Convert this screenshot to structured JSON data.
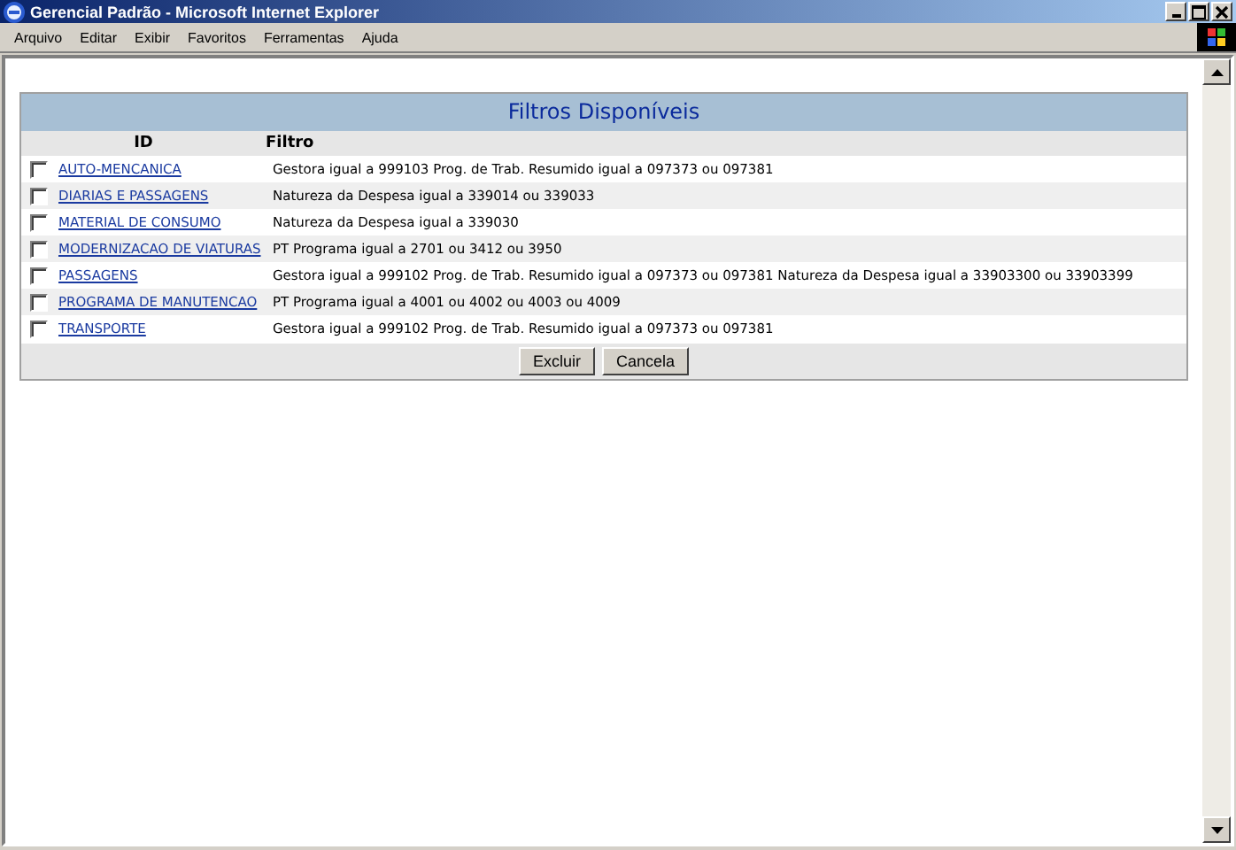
{
  "window": {
    "title": "Gerencial Padrão - Microsoft Internet Explorer"
  },
  "menu": [
    "Arquivo",
    "Editar",
    "Exibir",
    "Favoritos",
    "Ferramentas",
    "Ajuda"
  ],
  "panel": {
    "title": "Filtros Disponíveis",
    "columns": [
      "ID",
      "Filtro"
    ],
    "rows": [
      {
        "id": "AUTO-MENCANICA",
        "filter": "Gestora igual a 999103 Prog. de Trab. Resumido igual a 097373 ou 097381",
        "checked": false
      },
      {
        "id": "DIARIAS E PASSAGENS",
        "filter": "Natureza da Despesa igual a 339014 ou 339033",
        "checked": false
      },
      {
        "id": "MATERIAL DE CONSUMO",
        "filter": "Natureza da Despesa igual a 339030",
        "checked": false
      },
      {
        "id": "MODERNIZACAO DE VIATURAS",
        "filter": "PT Programa igual a 2701 ou 3412 ou 3950",
        "checked": false
      },
      {
        "id": "PASSAGENS",
        "filter": "Gestora igual a 999102 Prog. de Trab. Resumido igual a 097373 ou 097381 Natureza da Despesa igual a 33903300 ou 33903399",
        "checked": false
      },
      {
        "id": "PROGRAMA DE MANUTENCAO",
        "filter": "PT Programa igual a 4001 ou 4002 ou 4003 ou 4009",
        "checked": false
      },
      {
        "id": "TRANSPORTE",
        "filter": "Gestora igual a 999102 Prog. de Trab. Resumido igual a 097373 ou 097381",
        "checked": false
      }
    ],
    "buttons": [
      "Excluir",
      "Cancela"
    ]
  }
}
